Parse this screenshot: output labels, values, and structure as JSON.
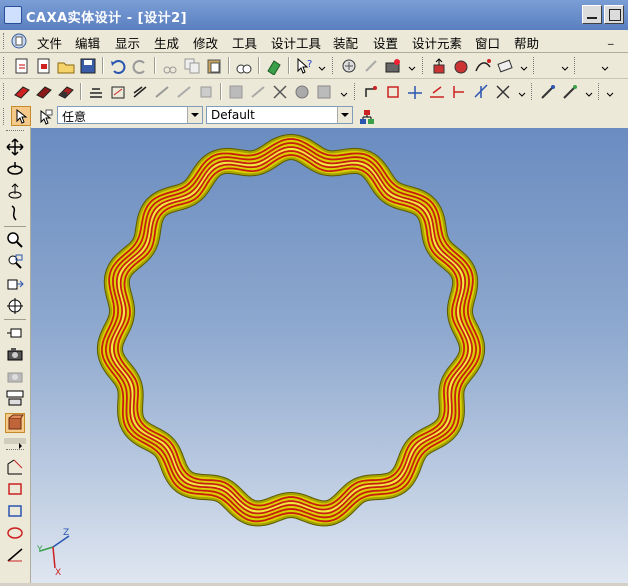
{
  "window": {
    "title": "CAXA实体设计 - [设计2]",
    "minimize_label": "",
    "maximize_label": ""
  },
  "menu": {
    "items": [
      "文件",
      "编辑",
      "显示",
      "生成",
      "修改",
      "工具",
      "设计工具",
      "装配",
      "设置",
      "设计元素",
      "窗口",
      "帮助"
    ]
  },
  "selection_bar": {
    "filter_value": "任意",
    "style_value": "Default"
  },
  "viewport": {
    "background_top": "#6a8cc0",
    "background_bottom": "#dfe6f0",
    "model": "wavy-ring",
    "model_color": "#d8d000",
    "stripe_color": "#c81e10",
    "triad": {
      "x_label": "X",
      "y_label": "Y",
      "z_label": "Z"
    }
  },
  "colors": {
    "titlebar": "#6b8fcf",
    "toolbar_bg": "#ece9d8"
  }
}
